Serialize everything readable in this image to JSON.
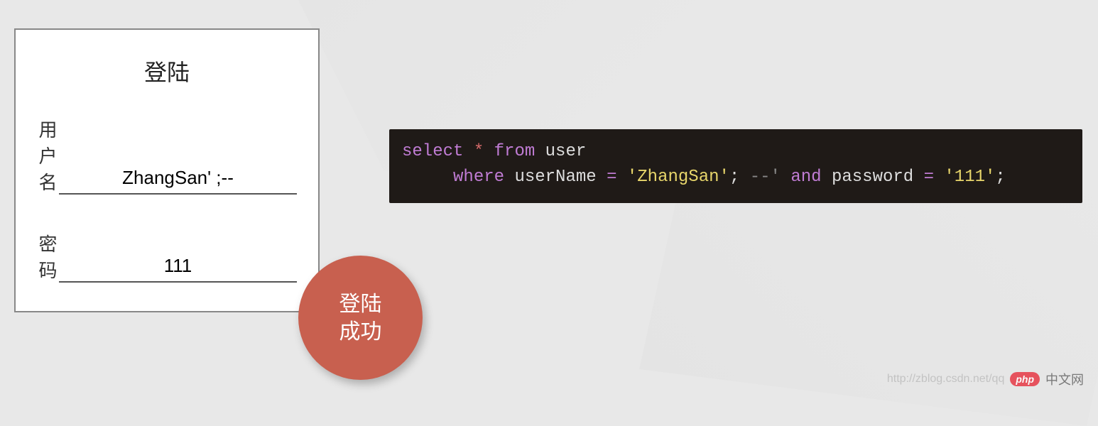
{
  "login": {
    "title": "登陆",
    "username_label": "用户名",
    "username_value": "ZhangSan' ;--",
    "password_label": "密码",
    "password_value": "111"
  },
  "badge": {
    "line1": "登陆",
    "line2": "成功"
  },
  "sql": {
    "select": "select",
    "star": "*",
    "from": "from",
    "table": "user",
    "where": "where",
    "col_user": "userName",
    "eq": "=",
    "val_user": "'ZhangSan'",
    "semi1": ";",
    "comment": "--'",
    "and": "and",
    "col_pass": "password",
    "val_pass": "'111'",
    "semi2": ";",
    "indent1": "",
    "indent2": "     "
  },
  "watermark": {
    "url": "http://zblog.csdn.net/qq",
    "logo": "php",
    "text": "中文网"
  }
}
